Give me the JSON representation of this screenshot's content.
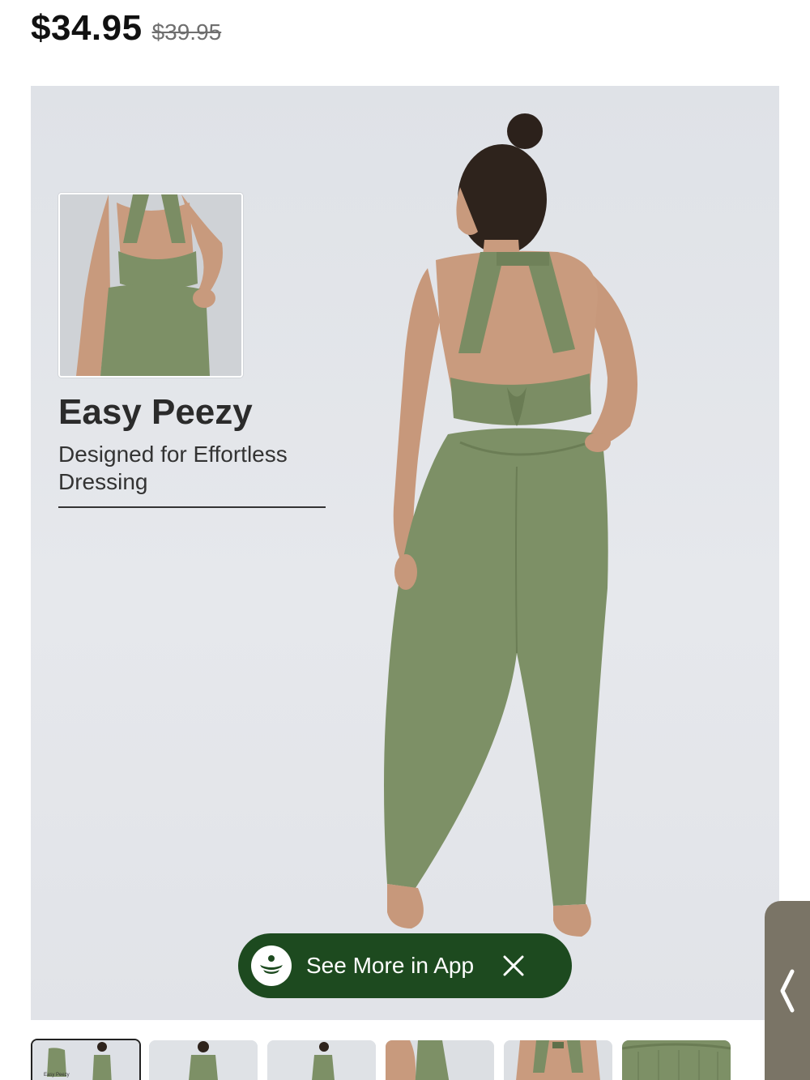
{
  "price": {
    "current": "$34.95",
    "original": "$39.95"
  },
  "feature": {
    "title": "Easy Peezy",
    "subtitle": "Designed for Effortless Dressing"
  },
  "app_banner": {
    "label": "See More in App",
    "close_icon": "close-icon",
    "logo_icon": "app-logo-icon"
  },
  "side_tab": {
    "icon": "chevron-left-icon"
  },
  "thumbnails": [
    {
      "label": "Easy Peezy",
      "selected": true
    },
    {
      "selected": false
    },
    {
      "selected": false
    },
    {
      "selected": false
    },
    {
      "selected": false
    },
    {
      "selected": false
    }
  ],
  "colors": {
    "product_green": "#7d9066",
    "banner_green": "#1d4a1f",
    "hero_bg": "#e0e3e8"
  }
}
